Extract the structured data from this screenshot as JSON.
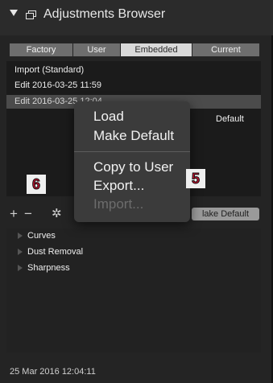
{
  "header": {
    "title": "Adjustments Browser"
  },
  "tabs": [
    {
      "label": "Factory",
      "active": false
    },
    {
      "label": "User",
      "active": false
    },
    {
      "label": "Embedded",
      "active": true
    },
    {
      "label": "Current",
      "active": false
    }
  ],
  "list": {
    "items": [
      "Import (Standard)",
      "Edit 2016-03-25 11:59",
      "Edit 2016-03-25 12:04"
    ],
    "selected_index": 2,
    "default_label": "Default"
  },
  "context_menu": {
    "items": [
      {
        "label": "Load",
        "enabled": true
      },
      {
        "label": "Make Default",
        "enabled": true
      },
      {
        "label": "Copy to User",
        "enabled": true
      },
      {
        "label": "Export...",
        "enabled": true
      },
      {
        "label": "Import...",
        "enabled": false
      }
    ]
  },
  "badges": {
    "left": "6",
    "right": "5"
  },
  "toolbar": {
    "add_icon": "plus-icon",
    "remove_icon": "minus-icon",
    "action_icon": "gear-icon",
    "make_default_label": "lake Default"
  },
  "tree": {
    "items": [
      "Curves",
      "Dust Removal",
      "Sharpness"
    ]
  },
  "status": {
    "date": "25 Mar 2016 12:04:11"
  },
  "colors": {
    "panel": "#242424",
    "list_bg": "#1b1b1b",
    "selection": "#4b4b4b",
    "badge_text": "#c8102e"
  }
}
